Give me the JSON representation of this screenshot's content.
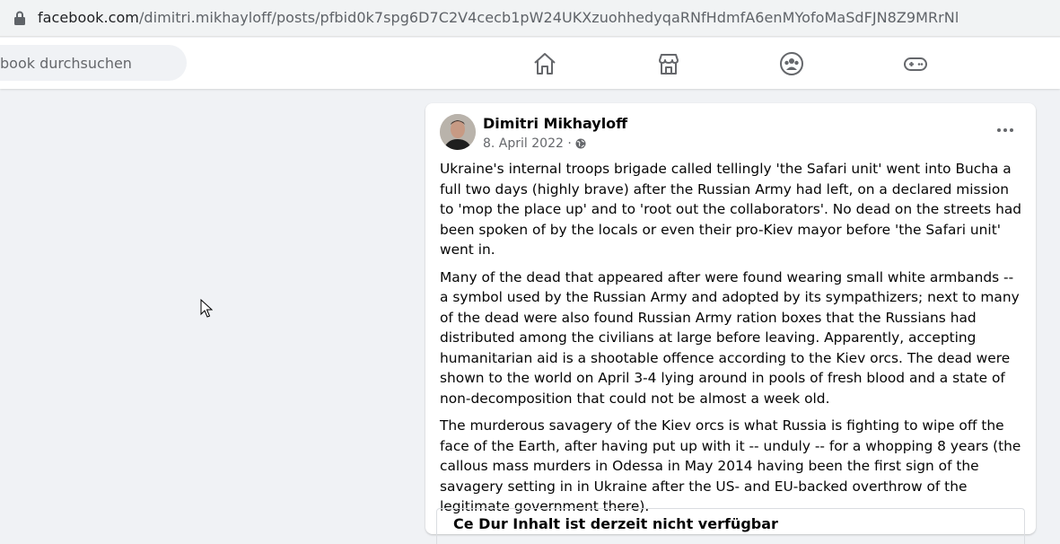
{
  "browser": {
    "url_host": "facebook.com",
    "url_path": "/dimitri.mikhayloff/posts/pfbid0k7spg6D7C2V4cecb1pW24UKXzuohhedyqaRNfHdmfA6enMYofoMaSdFJN8Z9MRrNl",
    "lock_icon": "lock-icon"
  },
  "topnav": {
    "search_placeholder": "book durchsuchen",
    "icons": [
      "home-icon",
      "marketplace-icon",
      "groups-icon",
      "gaming-icon"
    ]
  },
  "post": {
    "author": "Dimitri Mikhayloff",
    "date": "8. April 2022 ·",
    "privacy_icon": "globe-icon",
    "paragraphs": [
      "Ukraine's internal troops brigade called tellingly 'the Safari unit' went into Bucha a full two days (highly brave) after the Russian Army had left, on a declared mission to 'mop the place up' and to 'root out the collaborators'. No dead on the streets had been spoken of by the locals or even their pro-Kiev mayor before 'the Safari unit' went in.",
      "Many of the dead that appeared after were found wearing small white armbands -- a symbol used by the Russian Army and adopted by its sympathizers; next to many of the dead were also found Russian Army ration boxes that the Russians had distributed among the civilians at large before leaving. Apparently, accepting humanitarian aid is a shootable offence according to the Kiev orcs. The dead were shown to the world on April 3-4 lying around in pools of fresh blood and a state of non-decomposition that could not be almost a week old.",
      "The murderous savagery of the Kiev orcs is what Russia is fighting to wipe off the face of the Earth, after having put up with it -- unduly -- for a whopping 8 years (the callous mass murders in Odessa in May 2014 having been the first sign of the savagery setting in in Ukraine after the US- and EU-backed overthrow of the legitimate government there)."
    ],
    "link_card_title": "Ce Dur Inhalt ist derzeit nicht verfügbar"
  },
  "colors": {
    "page_bg": "#f0f2f5",
    "card_bg": "#ffffff",
    "icon_gray": "#65676b",
    "text": "#050505"
  }
}
